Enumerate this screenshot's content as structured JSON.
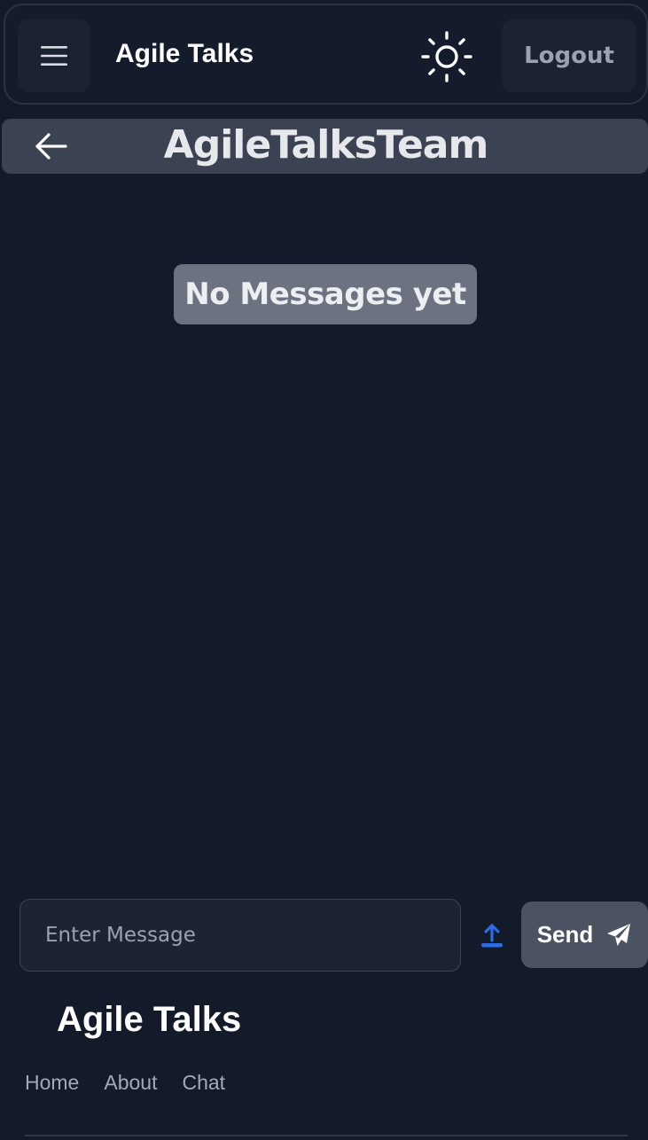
{
  "navbar": {
    "brand": "Agile Talks",
    "logout_label": "Logout"
  },
  "chat": {
    "title": "AgileTalksTeam",
    "empty_text": "No Messages yet"
  },
  "composer": {
    "placeholder": "Enter Message",
    "value": "",
    "send_label": "Send"
  },
  "footer": {
    "brand": "Agile Talks",
    "links": [
      "Home",
      "About",
      "Chat"
    ]
  },
  "colors": {
    "background": "#131a29",
    "header_bar": "#3b4352",
    "upload_icon": "#2e6be6"
  },
  "icons": [
    "menu-icon",
    "sun-icon",
    "arrow-left-icon",
    "upload-icon",
    "paper-plane-icon"
  ]
}
